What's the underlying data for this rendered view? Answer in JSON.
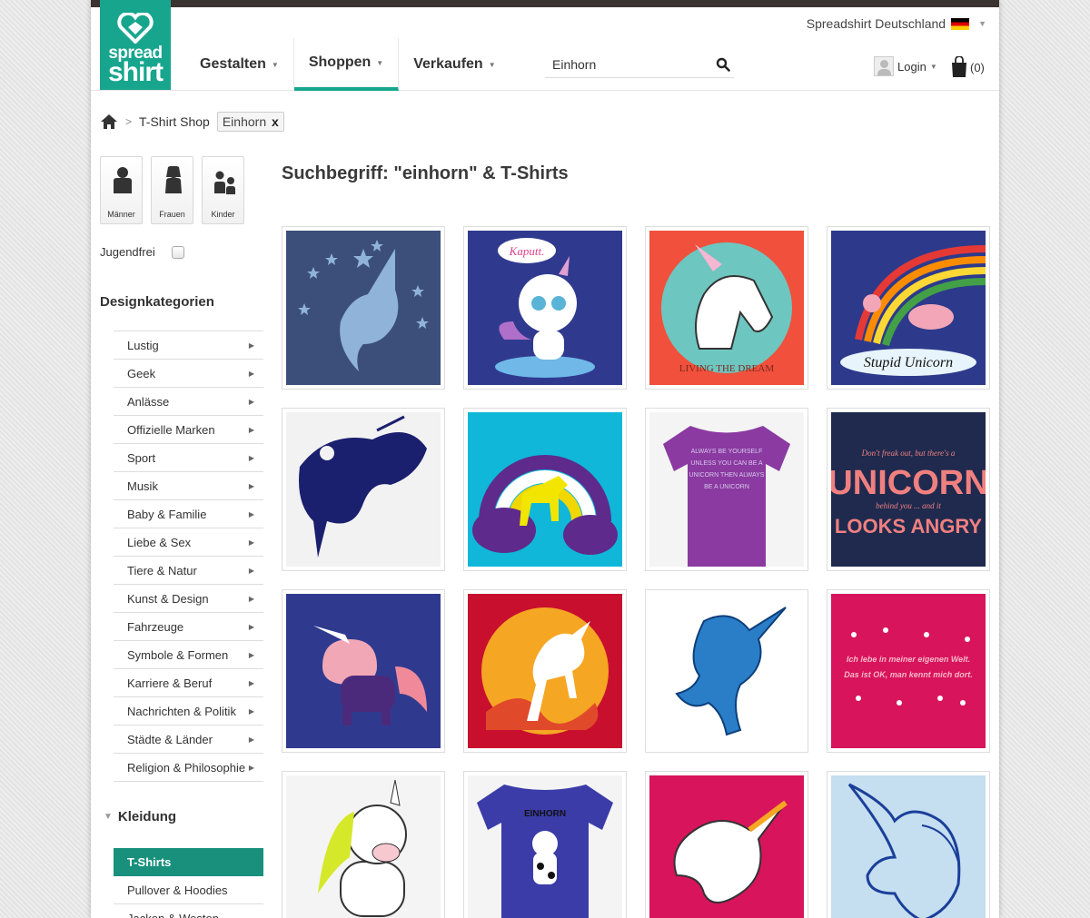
{
  "header": {
    "logo_line1": "spread",
    "logo_line2": "shirt",
    "country": "Spreadshirt Deutschland",
    "nav": [
      "Gestalten",
      "Shoppen",
      "Verkaufen"
    ],
    "search_value": "Einhorn",
    "login": "Login",
    "cart_count": "(0)"
  },
  "breadcrumb": {
    "shop": "T-Shirt Shop",
    "filter": "Einhorn",
    "filter_remove": "x"
  },
  "sidebar": {
    "gender": [
      "Männer",
      "Frauen",
      "Kinder"
    ],
    "jugendfrei": "Jugendfrei",
    "categories_title": "Designkategorien",
    "categories": [
      "Lustig",
      "Geek",
      "Anlässe",
      "Offizielle Marken",
      "Sport",
      "Musik",
      "Baby & Familie",
      "Liebe & Sex",
      "Tiere & Natur",
      "Kunst & Design",
      "Fahrzeuge",
      "Symbole & Formen",
      "Karriere & Beruf",
      "Nachrichten & Politik",
      "Städte & Länder",
      "Religion & Philosophie"
    ],
    "clothing_title": "Kleidung",
    "clothing": [
      "T-Shirts",
      "Pullover & Hoodies",
      "Jacken & Westen"
    ]
  },
  "main": {
    "headline": "Suchbegriff: \"einhorn\" & T-Shirts",
    "products": [
      {
        "bg": "#3c4f7a",
        "text": ""
      },
      {
        "bg": "#2f3a8f",
        "text": "Kaputt."
      },
      {
        "bg": "#f0503c",
        "text": "LIVING THE DREAM"
      },
      {
        "bg": "#2d3a8c",
        "text": "Stupid Unicorn"
      },
      {
        "bg": "#f2f2f2",
        "text": ""
      },
      {
        "bg": "#10b7d8",
        "text": ""
      },
      {
        "bg": "#f4f4f4",
        "text": "ALWAYS BE YOURSELF UNLESS YOU CAN BE A UNICORN THEN ALWAYS BE A UNICORN"
      },
      {
        "bg": "#1f2a4e",
        "text": "Don't freak out, but there's a UNICORN behind you ... and it LOOKS ANGRY"
      },
      {
        "bg": "#2f3a8f",
        "text": ""
      },
      {
        "bg": "#c8102e",
        "text": ""
      },
      {
        "bg": "#ffffff",
        "text": ""
      },
      {
        "bg": "#d8145c",
        "text": "Ich lebe in meiner eigenen Welt. Das ist OK, man kennt mich dort."
      },
      {
        "bg": "#f4f4f4",
        "text": ""
      },
      {
        "bg": "#f4f4f4",
        "text": "EINHORN"
      },
      {
        "bg": "#d8145c",
        "text": ""
      },
      {
        "bg": "#c5def0",
        "text": ""
      }
    ]
  },
  "colors": {
    "brand": "#18a58e",
    "topbar": "#3b3330"
  }
}
